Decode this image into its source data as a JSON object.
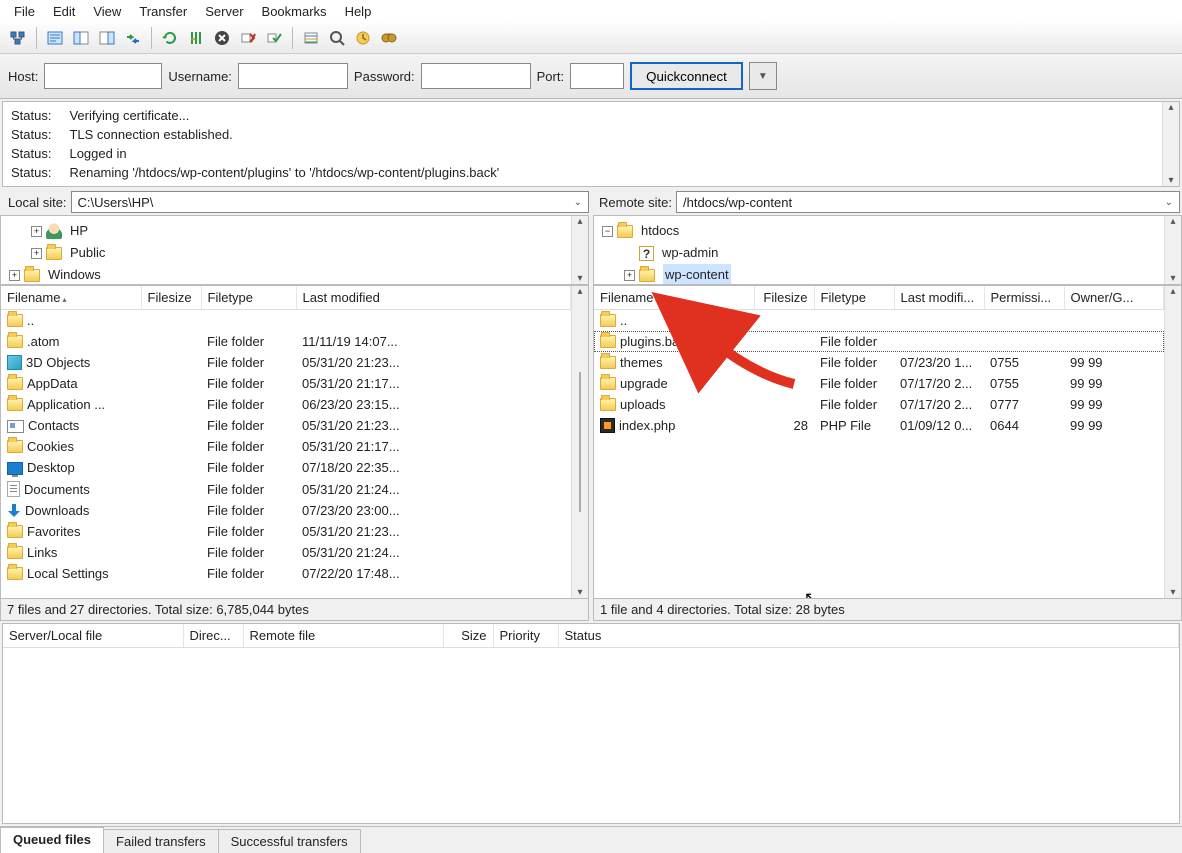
{
  "menu": [
    "File",
    "Edit",
    "View",
    "Transfer",
    "Server",
    "Bookmarks",
    "Help"
  ],
  "quickbar": {
    "host_label": "Host:",
    "username_label": "Username:",
    "password_label": "Password:",
    "port_label": "Port:",
    "quickconnect": "Quickconnect"
  },
  "log": [
    {
      "label": "Status:",
      "msg": "Verifying certificate..."
    },
    {
      "label": "Status:",
      "msg": "TLS connection established."
    },
    {
      "label": "Status:",
      "msg": "Logged in"
    },
    {
      "label": "Status:",
      "msg": "Renaming '/htdocs/wp-content/plugins' to '/htdocs/wp-content/plugins.back'"
    }
  ],
  "local": {
    "site_label": "Local site:",
    "path": "C:\\Users\\HP\\",
    "tree": [
      {
        "depth": 1,
        "exp": "+",
        "icon": "hp",
        "name": "HP"
      },
      {
        "depth": 1,
        "exp": "+",
        "icon": "folder",
        "name": "Public"
      },
      {
        "depth": 0,
        "exp": "+",
        "icon": "folder",
        "name": "Windows"
      }
    ],
    "columns": [
      "Filename",
      "Filesize",
      "Filetype",
      "Last modified"
    ],
    "rows": [
      {
        "icon": "folder",
        "name": "..",
        "size": "",
        "type": "",
        "mod": ""
      },
      {
        "icon": "folder",
        "name": ".atom",
        "size": "",
        "type": "File folder",
        "mod": "11/11/19 14:07..."
      },
      {
        "icon": "cube",
        "name": "3D Objects",
        "size": "",
        "type": "File folder",
        "mod": "05/31/20 21:23..."
      },
      {
        "icon": "folder",
        "name": "AppData",
        "size": "",
        "type": "File folder",
        "mod": "05/31/20 21:17..."
      },
      {
        "icon": "folder",
        "name": "Application ...",
        "size": "",
        "type": "File folder",
        "mod": "06/23/20 23:15..."
      },
      {
        "icon": "card",
        "name": "Contacts",
        "size": "",
        "type": "File folder",
        "mod": "05/31/20 21:23..."
      },
      {
        "icon": "folder",
        "name": "Cookies",
        "size": "",
        "type": "File folder",
        "mod": "05/31/20 21:17..."
      },
      {
        "icon": "mon",
        "name": "Desktop",
        "size": "",
        "type": "File folder",
        "mod": "07/18/20 22:35..."
      },
      {
        "icon": "doc",
        "name": "Documents",
        "size": "",
        "type": "File folder",
        "mod": "05/31/20 21:24..."
      },
      {
        "icon": "dl",
        "name": "Downloads",
        "size": "",
        "type": "File folder",
        "mod": "07/23/20 23:00..."
      },
      {
        "icon": "folder",
        "name": "Favorites",
        "size": "",
        "type": "File folder",
        "mod": "05/31/20 21:23..."
      },
      {
        "icon": "folder",
        "name": "Links",
        "size": "",
        "type": "File folder",
        "mod": "05/31/20 21:24..."
      },
      {
        "icon": "folder",
        "name": "Local Settings",
        "size": "",
        "type": "File folder",
        "mod": "07/22/20 17:48..."
      }
    ],
    "status": "7 files and 27 directories. Total size: 6,785,044 bytes"
  },
  "remote": {
    "site_label": "Remote site:",
    "path": "/htdocs/wp-content",
    "tree": [
      {
        "depth": 0,
        "exp": "-",
        "icon": "folder",
        "name": "htdocs"
      },
      {
        "depth": 1,
        "exp": "",
        "icon": "q",
        "name": "wp-admin"
      },
      {
        "depth": 1,
        "exp": "+",
        "icon": "folder",
        "name": "wp-content",
        "sel": true
      }
    ],
    "columns": [
      "Filename",
      "Filesize",
      "Filetype",
      "Last modifi...",
      "Permissi...",
      "Owner/G..."
    ],
    "rows": [
      {
        "icon": "folder",
        "name": "..",
        "size": "",
        "type": "",
        "mod": "",
        "perm": "",
        "own": ""
      },
      {
        "icon": "folder",
        "name": "plugins.back",
        "size": "",
        "type": "File folder",
        "mod": "",
        "perm": "",
        "own": "",
        "sel": true
      },
      {
        "icon": "folder",
        "name": "themes",
        "size": "",
        "type": "File folder",
        "mod": "07/23/20 1...",
        "perm": "0755",
        "own": "99 99"
      },
      {
        "icon": "folder",
        "name": "upgrade",
        "size": "",
        "type": "File folder",
        "mod": "07/17/20 2...",
        "perm": "0755",
        "own": "99 99"
      },
      {
        "icon": "folder",
        "name": "uploads",
        "size": "",
        "type": "File folder",
        "mod": "07/17/20 2...",
        "perm": "0777",
        "own": "99 99"
      },
      {
        "icon": "php",
        "name": "index.php",
        "size": "28",
        "type": "PHP File",
        "mod": "01/09/12 0...",
        "perm": "0644",
        "own": "99 99"
      }
    ],
    "status": "1 file and 4 directories. Total size: 28 bytes"
  },
  "queue": {
    "columns": [
      "Server/Local file",
      "Direc...",
      "Remote file",
      "Size",
      "Priority",
      "Status"
    ]
  },
  "tabs": [
    "Queued files",
    "Failed transfers",
    "Successful transfers"
  ]
}
